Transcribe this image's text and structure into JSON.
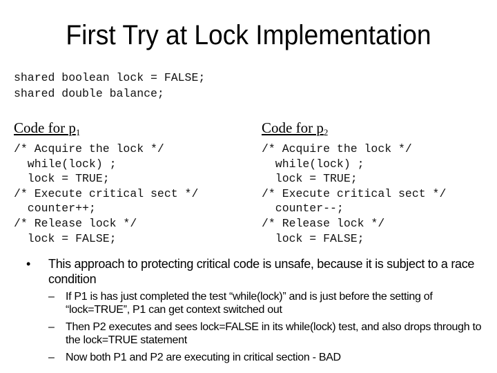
{
  "slide": {
    "title": "First Try at Lock Implementation",
    "declarations": [
      "shared boolean lock = FALSE;",
      "shared double balance;"
    ],
    "columns": [
      {
        "heading": "Code for p",
        "subscript": "1",
        "code": [
          "/* Acquire the lock */",
          "  while(lock) ;",
          "  lock = TRUE;",
          "/* Execute critical sect */",
          "  counter++;",
          "/* Release lock */",
          "  lock = FALSE;"
        ]
      },
      {
        "heading": "Code for p",
        "subscript": "2",
        "code": [
          "/* Acquire the lock */",
          "  while(lock) ;",
          "  lock = TRUE;",
          "/* Execute critical sect */",
          "  counter--;",
          "/* Release lock */",
          "  lock = FALSE;"
        ]
      }
    ],
    "bullet": {
      "marker": "•",
      "text": "This approach to protecting critical code is unsafe, because it is subject to a race condition",
      "sub_marker": "–",
      "sub_items": [
        "If P1 is has just completed the test “while(lock)” and is just before the setting of “lock=TRUE”, P1 can get context switched out",
        "Then P2 executes and sees lock=FALSE in its while(lock) test, and also drops through to the lock=TRUE statement",
        "Now both P1 and P2 are executing in critical section - BAD"
      ]
    }
  }
}
